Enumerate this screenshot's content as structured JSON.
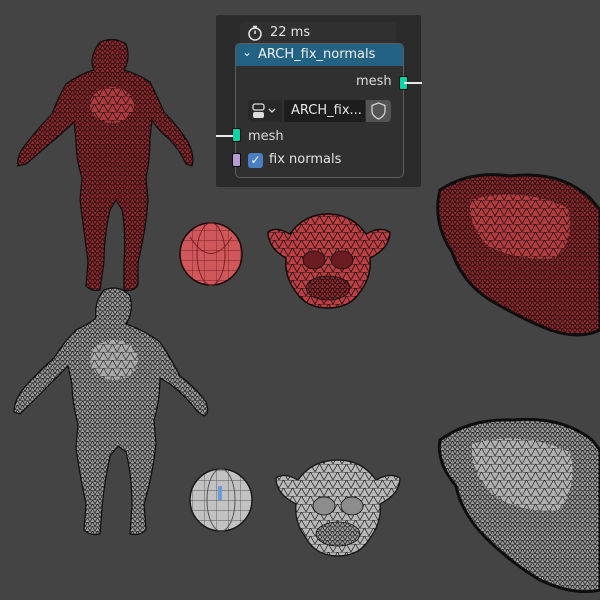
{
  "overlay": {
    "timing": "22 ms",
    "node": {
      "title": "ARCH_fix_normals",
      "output_socket": "mesh",
      "group_name": "ARCH_fix...",
      "input_socket": "mesh",
      "checkbox_label": "fix normals",
      "checkbox_checked": true
    }
  },
  "colors": {
    "background": "#444444",
    "node_header": "#246283",
    "geometry_socket": "#00d6a3",
    "boolean_socket": "#b49bd4",
    "flipped_faces": "#c8484c",
    "fixed_faces": "#bdbdbd"
  },
  "icons": [
    "stopwatch-icon",
    "chevron-down-icon",
    "node-tree-icon",
    "shield-icon",
    "checkmark-icon"
  ]
}
